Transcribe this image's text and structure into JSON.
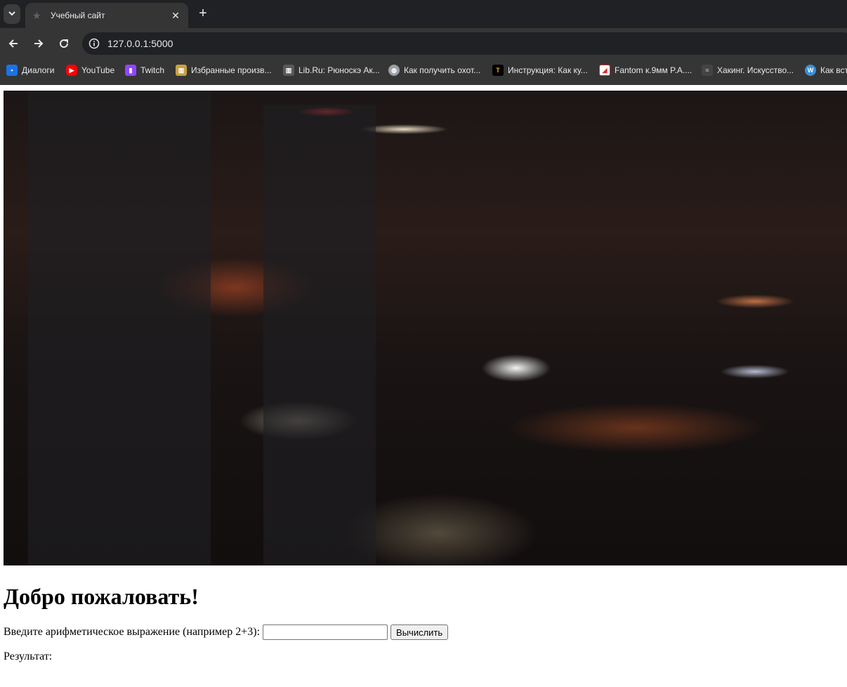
{
  "browser": {
    "tab": {
      "title": "Учебный сайт"
    },
    "address": {
      "url": "127.0.0.1:5000"
    },
    "bookmarks": [
      {
        "label": "Диалоги",
        "icon": "chat-icon",
        "color": "#1a73e8"
      },
      {
        "label": "YouTube",
        "icon": "youtube-icon",
        "color": "#ff0000"
      },
      {
        "label": "Twitch",
        "icon": "twitch-icon",
        "color": "#9146ff"
      },
      {
        "label": "Избранные произв...",
        "icon": "book-icon",
        "color": "#c8a040"
      },
      {
        "label": "Lib.Ru: Рюноскэ Ак...",
        "icon": "library-icon",
        "color": "#aaaaaa"
      },
      {
        "label": "Как получить охот...",
        "icon": "globe-icon",
        "color": "#9aa0a6"
      },
      {
        "label": "Инструкция: Как ку...",
        "icon": "t-icon",
        "color": "#f0b400"
      },
      {
        "label": "Fantom к.9мм P.A....",
        "icon": "fantom-icon",
        "color": "#d32f2f"
      },
      {
        "label": "Хакинг. Искусство...",
        "icon": "hacking-icon",
        "color": "#777777"
      },
      {
        "label": "Как вст",
        "icon": "wordpress-icon",
        "color": "#3b8fd9"
      }
    ]
  },
  "page": {
    "heading": "Добро пожаловать!",
    "form": {
      "label": "Введите арифметическое выражение (например 2+3):",
      "input_value": "",
      "button_label": "Вычислить"
    },
    "result_label": "Результат:"
  }
}
